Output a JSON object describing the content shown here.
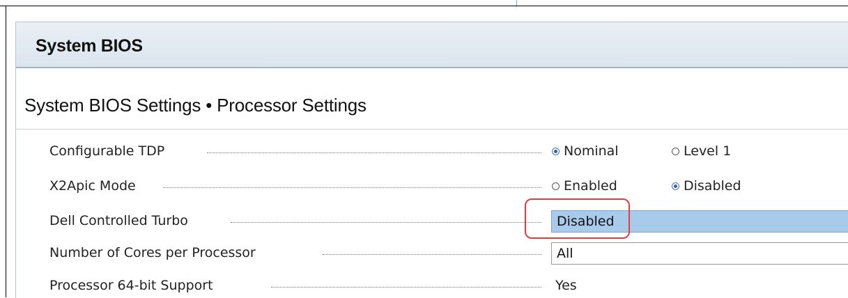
{
  "window": {
    "title": "System BIOS",
    "subtitle": "System BIOS Settings • Processor Settings"
  },
  "settings": [
    {
      "label": "Configurable TDP",
      "type": "radio",
      "options": [
        {
          "label": "Nominal",
          "selected": true
        },
        {
          "label": "Level 1",
          "selected": false
        }
      ]
    },
    {
      "label": "X2Apic Mode",
      "type": "radio",
      "options": [
        {
          "label": "Enabled",
          "selected": false
        },
        {
          "label": "Disabled",
          "selected": true
        }
      ]
    },
    {
      "label": "Dell Controlled Turbo",
      "type": "select",
      "value": "Disabled",
      "highlighted": true
    },
    {
      "label": "Number of Cores per Processor",
      "type": "select",
      "value": "All",
      "highlighted": false
    },
    {
      "label": "Processor 64-bit Support",
      "type": "text",
      "value": "Yes"
    }
  ],
  "colors": {
    "title_bar": "#dbe5ee",
    "selected_field": "#a9cbeb",
    "callout": "#e53b3b",
    "radio_selected": "#2d5fa8"
  },
  "icons": [
    "radio-selected-icon",
    "radio-unselected-icon"
  ]
}
